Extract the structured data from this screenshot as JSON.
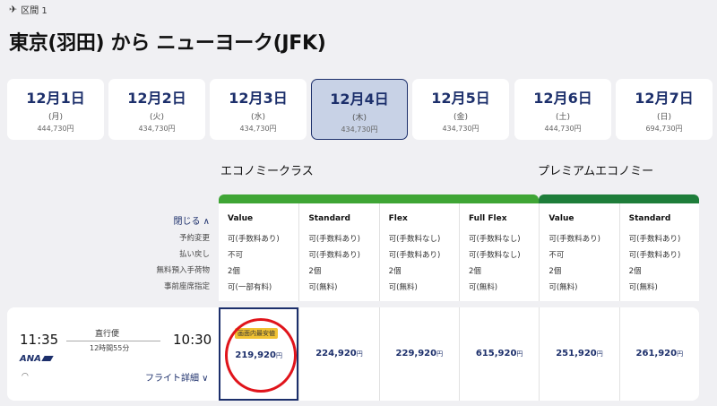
{
  "segment": {
    "label": "区間 1"
  },
  "route": {
    "title": "東京(羽田) から ニューヨーク(JFK)"
  },
  "dates": [
    {
      "day": "12月1日",
      "weekday": "(月)",
      "price": "444,730円",
      "selected": false
    },
    {
      "day": "12月2日",
      "weekday": "(火)",
      "price": "434,730円",
      "selected": false
    },
    {
      "day": "12月3日",
      "weekday": "(水)",
      "price": "434,730円",
      "selected": false
    },
    {
      "day": "12月4日",
      "weekday": "(木)",
      "price": "434,730円",
      "selected": true
    },
    {
      "day": "12月5日",
      "weekday": "(金)",
      "price": "434,730円",
      "selected": false
    },
    {
      "day": "12月6日",
      "weekday": "(土)",
      "price": "444,730円",
      "selected": false
    },
    {
      "day": "12月7日",
      "weekday": "(日)",
      "price": "694,730円",
      "selected": false
    }
  ],
  "cabins": {
    "economy": {
      "label": "エコノミークラス",
      "color": "#3fa535"
    },
    "premium": {
      "label": "プレミアムエコノミー",
      "color": "#1e7d3a"
    }
  },
  "row_labels": {
    "close": "閉じる ∧",
    "items": [
      "予約変更",
      "払い戻し",
      "無料預入手荷物",
      "事前座席指定"
    ]
  },
  "fares": [
    {
      "name": "Value",
      "cells": [
        "可(手数料あり)",
        "不可",
        "2個",
        "可(一部有料)"
      ],
      "price": "219,920",
      "selected": true
    },
    {
      "name": "Standard",
      "cells": [
        "可(手数料あり)",
        "可(手数料あり)",
        "2個",
        "可(無料)"
      ],
      "price": "224,920",
      "selected": false
    },
    {
      "name": "Flex",
      "cells": [
        "可(手数料なし)",
        "可(手数料あり)",
        "2個",
        "可(無料)"
      ],
      "price": "229,920",
      "selected": false
    },
    {
      "name": "Full Flex",
      "cells": [
        "可(手数料なし)",
        "可(手数料なし)",
        "2個",
        "可(無料)"
      ],
      "price": "615,920",
      "selected": false
    },
    {
      "name": "Value",
      "cells": [
        "可(手数料あり)",
        "不可",
        "2個",
        "可(無料)"
      ],
      "price": "251,920",
      "selected": false
    },
    {
      "name": "Standard",
      "cells": [
        "可(手数料あり)",
        "可(手数料あり)",
        "2個",
        "可(無料)"
      ],
      "price": "261,920",
      "selected": false
    }
  ],
  "yen": "円",
  "badge": "画面内最安値",
  "flight": {
    "dep": "11:35",
    "arr": "10:30",
    "nonstop": "直行便",
    "duration": "12時間55分",
    "airline": "ANA",
    "details": "フライト詳細 ∨"
  }
}
